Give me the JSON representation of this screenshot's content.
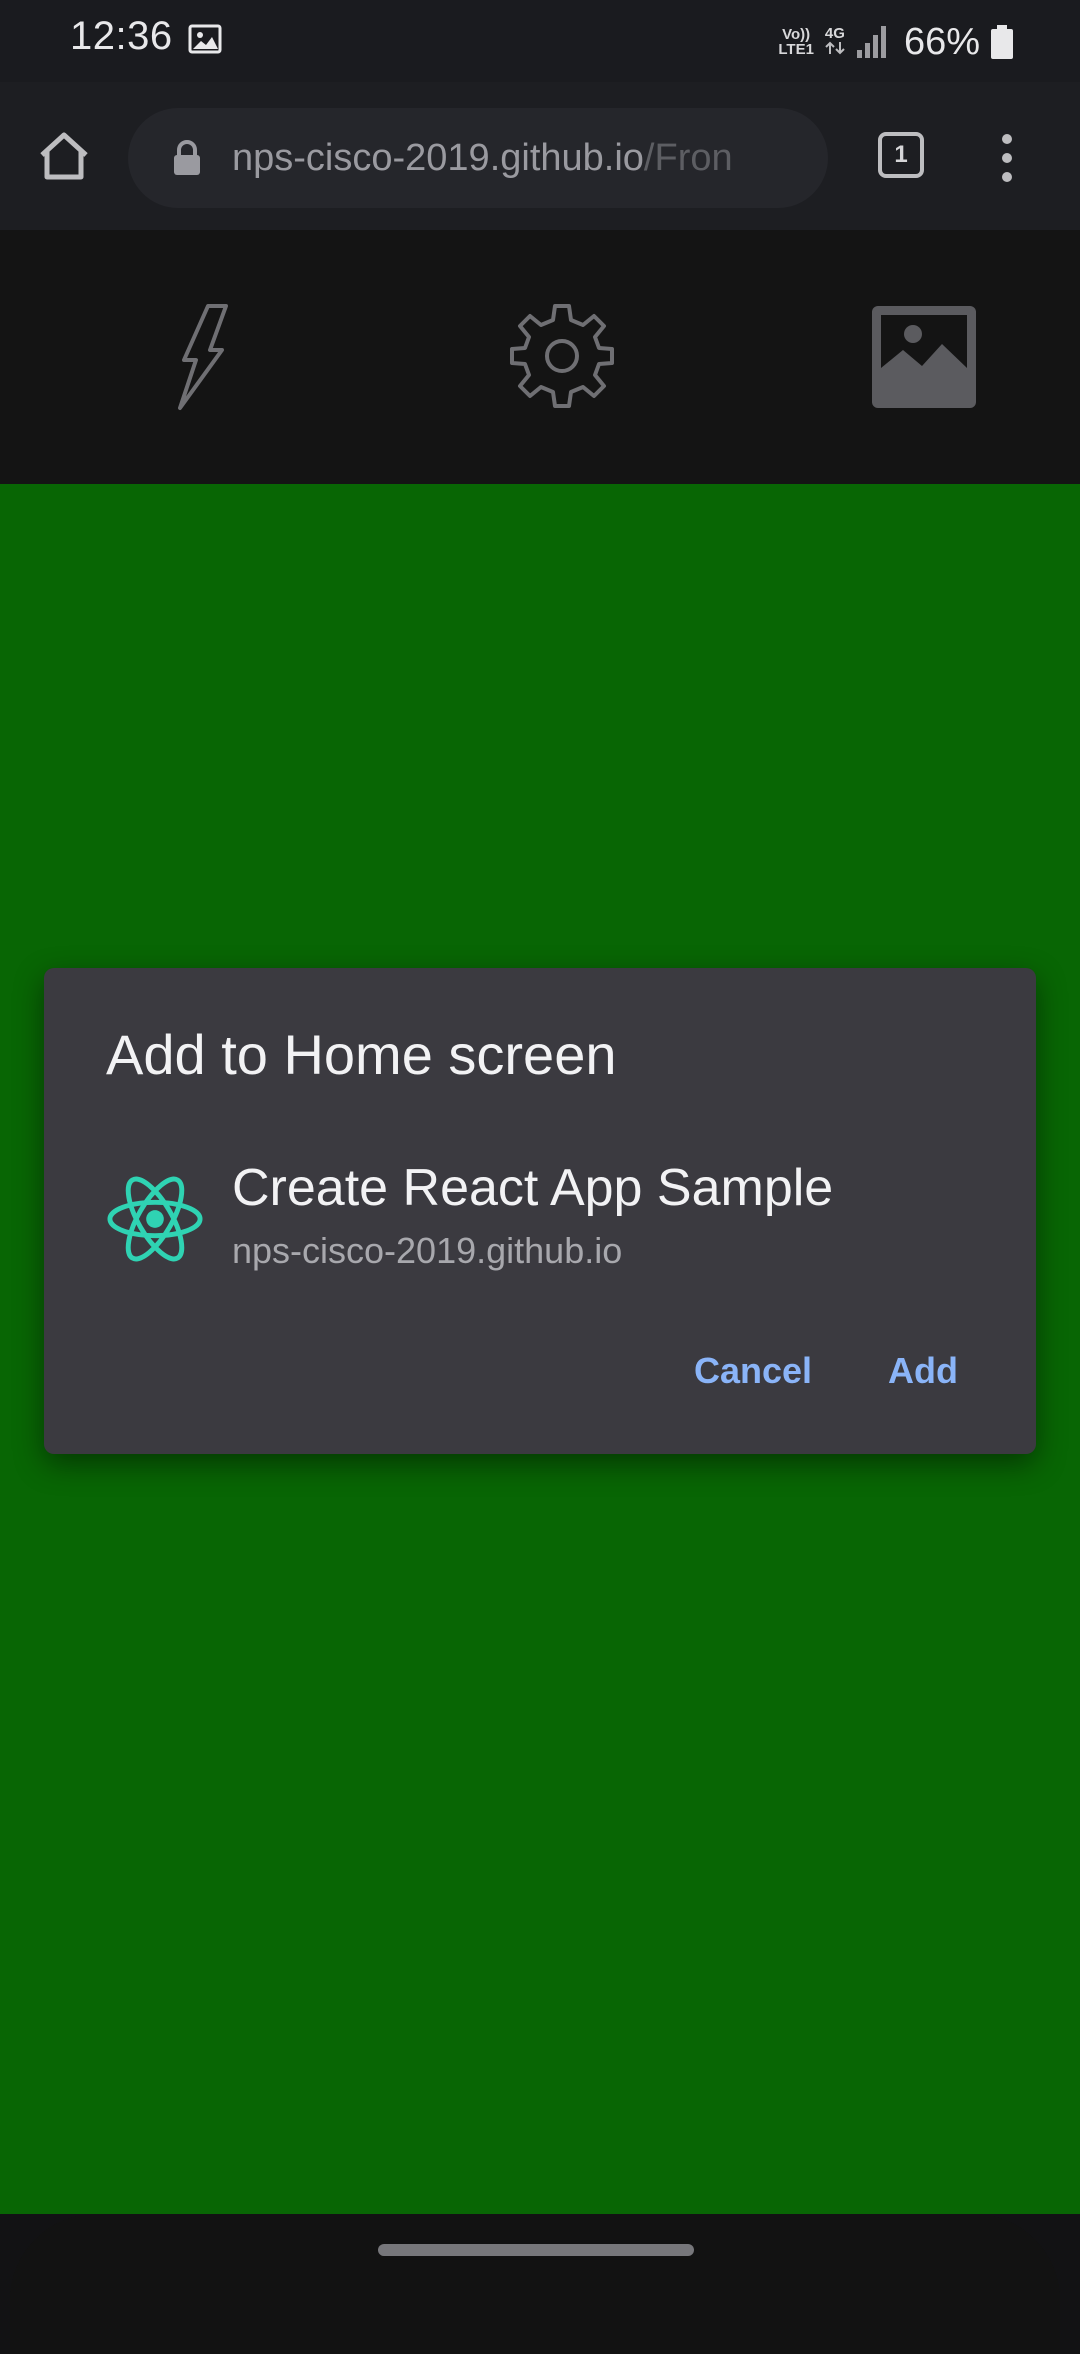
{
  "status_bar": {
    "time": "12:36",
    "volte_line1": "Vo))",
    "volte_line2": "LTE1",
    "network_type": "4G",
    "battery_percent": "66%"
  },
  "browser": {
    "url_host": "nps-cisco-2019.github.io",
    "url_path": "/Fron",
    "tab_count": "1"
  },
  "toolbar": {
    "icons": [
      "flash-icon",
      "gear-icon",
      "image-icon"
    ]
  },
  "dialog": {
    "title": "Add to Home screen",
    "app_name": "Create React App Sample",
    "app_origin": "nps-cisco-2019.github.io",
    "cancel_label": "Cancel",
    "add_label": "Add"
  },
  "colors": {
    "page_background": "#086604",
    "dialog_background": "#3b3a40",
    "button_accent": "#8ab4f8",
    "react_logo": "#2fd3b3"
  }
}
